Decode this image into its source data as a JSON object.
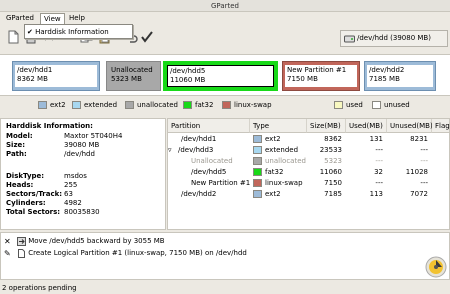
{
  "window": {
    "title": "GParted"
  },
  "menubar": {
    "items": [
      {
        "label": "GParted"
      },
      {
        "label": "View"
      },
      {
        "label": "Help"
      }
    ]
  },
  "menu": {
    "view_items": [
      {
        "label": "Harddisk Information",
        "checked": true
      }
    ]
  },
  "device_selector": {
    "label": "/dev/hdd  (39080 MB)"
  },
  "graph": {
    "partitions": [
      {
        "name": "/dev/hdd1",
        "size": "8362 MB",
        "type": "ext2"
      },
      {
        "name": "Unallocated",
        "size": "5323 MB",
        "type": "unallocated"
      },
      {
        "name": "/dev/hdd5",
        "size": "11060 MB",
        "type": "fat32",
        "selected": true
      },
      {
        "name": "New Partition #1",
        "size": "7150 MB",
        "type": "linux-swap"
      },
      {
        "name": "/dev/hdd2",
        "size": "7185 MB",
        "type": "ext2"
      }
    ]
  },
  "legend": {
    "items": [
      {
        "label": "ext2",
        "color": "#9dbbd8"
      },
      {
        "label": "extended",
        "color": "#a8d8f0"
      },
      {
        "label": "unallocated",
        "color": "#a8a8a8"
      },
      {
        "label": "fat32",
        "color": "#18d918"
      },
      {
        "label": "linux-swap",
        "color": "#c1665a"
      }
    ],
    "right_items": [
      {
        "label": "used",
        "color": "#f8f8c0"
      },
      {
        "label": "unused",
        "color": "#ffffff"
      }
    ]
  },
  "harddisk_info": {
    "heading": "Harddisk Information:",
    "group1": [
      {
        "key": "Model:",
        "value": "Maxtor 5T040H4"
      },
      {
        "key": "Size:",
        "value": "39080 MB"
      },
      {
        "key": "Path:",
        "value": "/dev/hdd"
      }
    ],
    "group2": [
      {
        "key": "DiskType:",
        "value": "msdos"
      },
      {
        "key": "Heads:",
        "value": "255"
      },
      {
        "key": "Sectors/Track:",
        "value": "63"
      },
      {
        "key": "Cylinders:",
        "value": "4982"
      },
      {
        "key": "Total Sectors:",
        "value": "80035830"
      }
    ]
  },
  "table": {
    "headers": [
      "Partition",
      "Type",
      "Size(MB)",
      "Used(MB)",
      "Unused(MB)",
      "Flags"
    ],
    "rows": [
      {
        "partition": "/dev/hdd1",
        "type": "ext2",
        "color": "#9dbbd8",
        "size": "8362",
        "used": "131",
        "unused": "8231",
        "flags": "",
        "indent": 1,
        "dim": false
      },
      {
        "partition": "/dev/hdd3",
        "type": "extended",
        "color": "#a8d8f0",
        "size": "23533",
        "used": "---",
        "unused": "---",
        "flags": "",
        "indent": 0,
        "expander": "▿",
        "dim": false
      },
      {
        "partition": "Unallocated",
        "type": "unallocated",
        "color": "#a8a8a8",
        "size": "5323",
        "used": "---",
        "unused": "---",
        "flags": "",
        "indent": 2,
        "dim": true
      },
      {
        "partition": "/dev/hdd5",
        "type": "fat32",
        "color": "#18d918",
        "size": "11060",
        "used": "32",
        "unused": "11028",
        "flags": "",
        "indent": 2,
        "dim": false
      },
      {
        "partition": "New Partition #1",
        "type": "linux-swap",
        "color": "#c1665a",
        "size": "7150",
        "used": "---",
        "unused": "---",
        "flags": "",
        "indent": 2,
        "dim": false
      },
      {
        "partition": "/dev/hdd2",
        "type": "ext2",
        "color": "#9dbbd8",
        "size": "7185",
        "used": "113",
        "unused": "7072",
        "flags": "",
        "indent": 1,
        "dim": false
      }
    ]
  },
  "operations": {
    "items": [
      {
        "label": "Move /dev/hdd5 backward by 3055 MB"
      },
      {
        "label": "Create Logical Partition #1 (linux-swap, 7150 MB) on /dev/hdd"
      }
    ]
  },
  "statusbar": {
    "text": "2 operations pending"
  }
}
